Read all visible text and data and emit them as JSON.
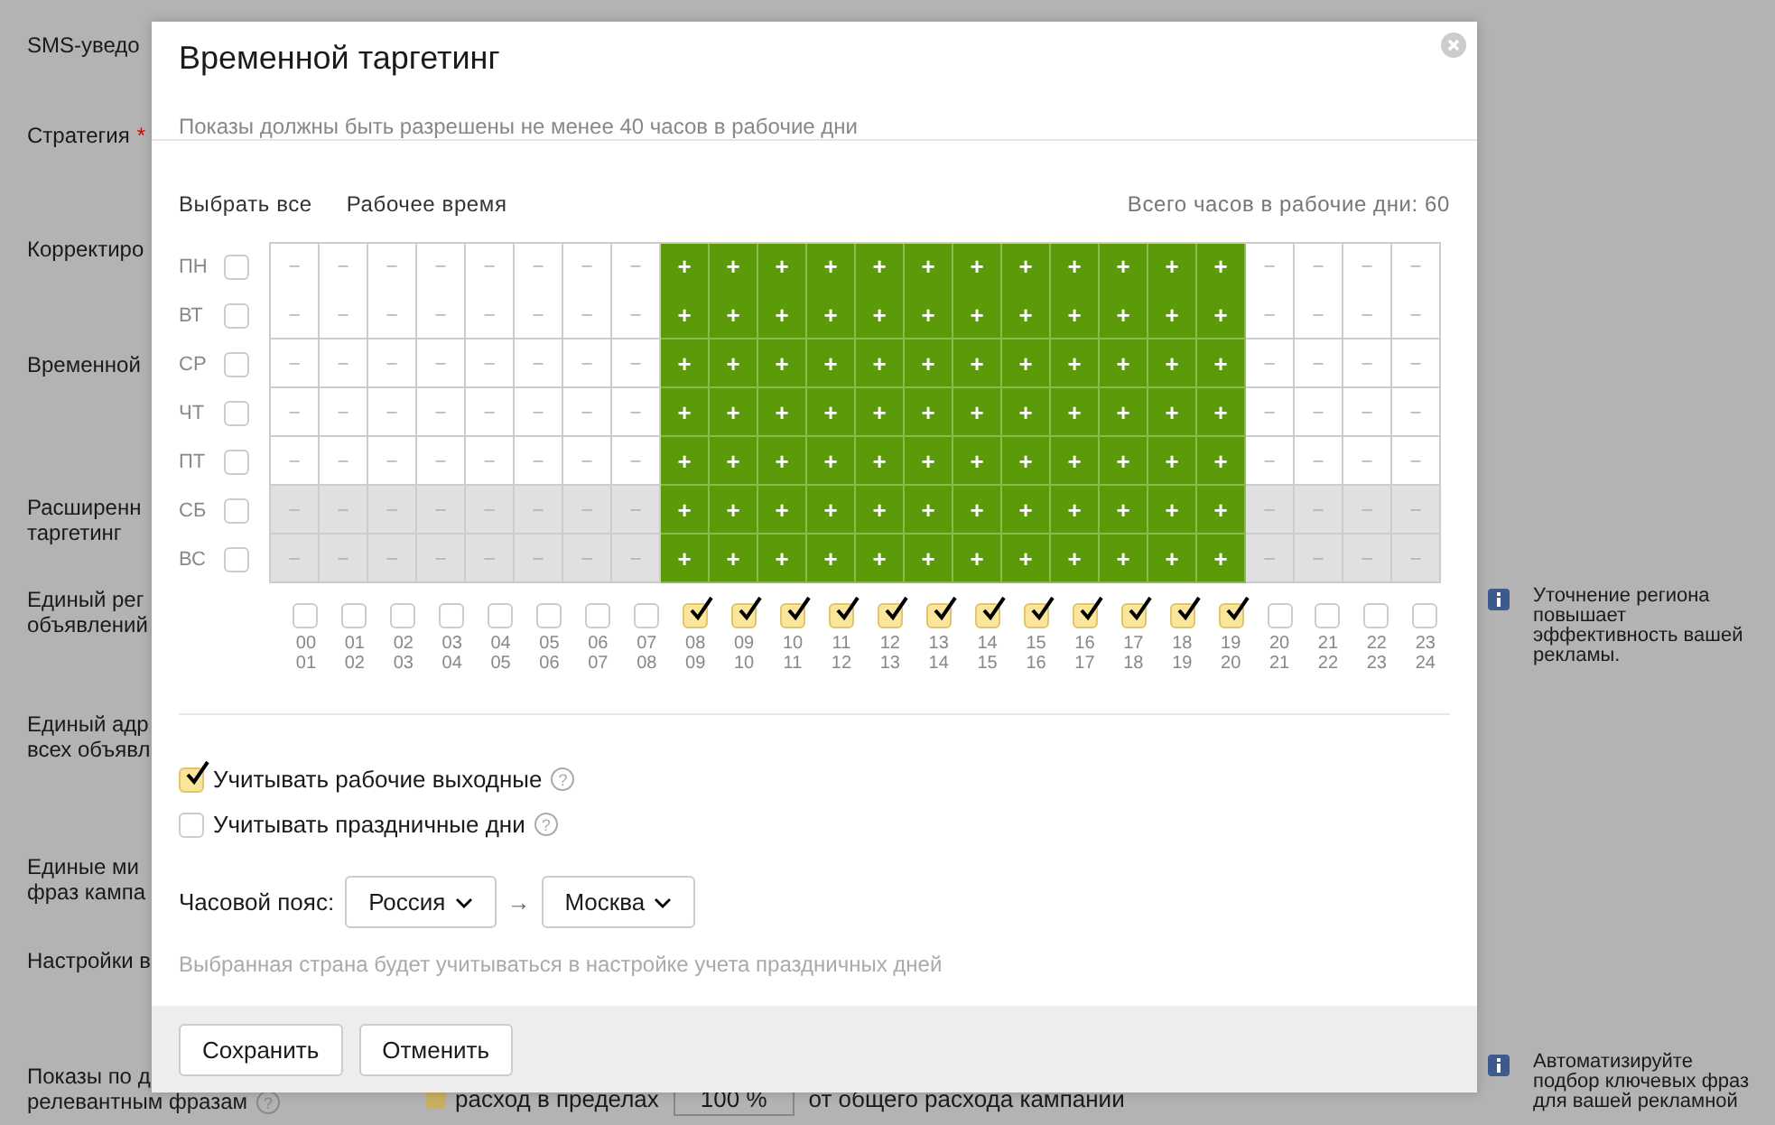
{
  "background_form": {
    "labels": [
      {
        "text": "SMS-уведо"
      },
      {
        "text": "Стратегия",
        "marker": "*"
      },
      {
        "text": "Корректиро"
      },
      {
        "text": "Временной"
      },
      {
        "text": "Расширенн\nтаргетинг"
      },
      {
        "text": "Единый рег\nобъявлений"
      },
      {
        "text": "Единый адр\nвсех объявл"
      },
      {
        "text": "Единые ми\nфраз кампа"
      },
      {
        "text": "Настройки в"
      },
      {
        "text": "Показы по д\nрелевантным фразам",
        "help": "?"
      }
    ],
    "hints": [
      "Уточнение региона повышает эффективность вашей рекламы.",
      "Автоматизируйте подбор ключевых фраз для вашей рекламной"
    ],
    "spend": {
      "checked": true,
      "label": "расход в пределах",
      "value": "100 %",
      "suffix": "от общего расхода кампании"
    }
  },
  "dialog": {
    "title": "Временной таргетинг",
    "subtitle": "Показы должны быть разрешены не менее 40 часов в рабочие дни",
    "links": [
      "Выбрать все",
      "Рабочее время"
    ],
    "total": "Всего часов в рабочие дни: 60",
    "days": [
      {
        "label": "ПН",
        "checked": false,
        "weekend": false,
        "cells": [
          {
            "mark": "–",
            "on": false
          },
          {
            "mark": "–",
            "on": false
          },
          {
            "mark": "–",
            "on": false
          },
          {
            "mark": "–",
            "on": false
          },
          {
            "mark": "–",
            "on": false
          },
          {
            "mark": "–",
            "on": false
          },
          {
            "mark": "–",
            "on": false
          },
          {
            "mark": "–",
            "on": false
          },
          {
            "mark": "+",
            "on": true
          },
          {
            "mark": "+",
            "on": true
          },
          {
            "mark": "+",
            "on": true
          },
          {
            "mark": "+",
            "on": true
          },
          {
            "mark": "+",
            "on": true
          },
          {
            "mark": "+",
            "on": true
          },
          {
            "mark": "+",
            "on": true
          },
          {
            "mark": "+",
            "on": true
          },
          {
            "mark": "+",
            "on": true
          },
          {
            "mark": "+",
            "on": true
          },
          {
            "mark": "+",
            "on": true
          },
          {
            "mark": "+",
            "on": true
          },
          {
            "mark": "–",
            "on": false
          },
          {
            "mark": "–",
            "on": false
          },
          {
            "mark": "–",
            "on": false
          },
          {
            "mark": "–",
            "on": false
          }
        ]
      },
      {
        "label": "ВТ",
        "checked": false,
        "weekend": false,
        "cells": [
          {
            "mark": "–",
            "on": false
          },
          {
            "mark": "–",
            "on": false
          },
          {
            "mark": "–",
            "on": false
          },
          {
            "mark": "–",
            "on": false
          },
          {
            "mark": "–",
            "on": false
          },
          {
            "mark": "–",
            "on": false
          },
          {
            "mark": "–",
            "on": false
          },
          {
            "mark": "–",
            "on": false
          },
          {
            "mark": "+",
            "on": true
          },
          {
            "mark": "+",
            "on": true
          },
          {
            "mark": "+",
            "on": true
          },
          {
            "mark": "+",
            "on": true
          },
          {
            "mark": "+",
            "on": true
          },
          {
            "mark": "+",
            "on": true
          },
          {
            "mark": "+",
            "on": true
          },
          {
            "mark": "+",
            "on": true
          },
          {
            "mark": "+",
            "on": true
          },
          {
            "mark": "+",
            "on": true
          },
          {
            "mark": "+",
            "on": true
          },
          {
            "mark": "+",
            "on": true
          },
          {
            "mark": "–",
            "on": false
          },
          {
            "mark": "–",
            "on": false
          },
          {
            "mark": "–",
            "on": false
          },
          {
            "mark": "–",
            "on": false
          }
        ]
      },
      {
        "label": "СР",
        "checked": false,
        "weekend": false,
        "cells": [
          {
            "mark": "–",
            "on": false
          },
          {
            "mark": "–",
            "on": false
          },
          {
            "mark": "–",
            "on": false
          },
          {
            "mark": "–",
            "on": false
          },
          {
            "mark": "–",
            "on": false
          },
          {
            "mark": "–",
            "on": false
          },
          {
            "mark": "–",
            "on": false
          },
          {
            "mark": "–",
            "on": false
          },
          {
            "mark": "+",
            "on": true
          },
          {
            "mark": "+",
            "on": true
          },
          {
            "mark": "+",
            "on": true
          },
          {
            "mark": "+",
            "on": true
          },
          {
            "mark": "+",
            "on": true
          },
          {
            "mark": "+",
            "on": true
          },
          {
            "mark": "+",
            "on": true
          },
          {
            "mark": "+",
            "on": true
          },
          {
            "mark": "+",
            "on": true
          },
          {
            "mark": "+",
            "on": true
          },
          {
            "mark": "+",
            "on": true
          },
          {
            "mark": "+",
            "on": true
          },
          {
            "mark": "–",
            "on": false
          },
          {
            "mark": "–",
            "on": false
          },
          {
            "mark": "–",
            "on": false
          },
          {
            "mark": "–",
            "on": false
          }
        ]
      },
      {
        "label": "ЧТ",
        "checked": false,
        "weekend": false,
        "cells": [
          {
            "mark": "–",
            "on": false
          },
          {
            "mark": "–",
            "on": false
          },
          {
            "mark": "–",
            "on": false
          },
          {
            "mark": "–",
            "on": false
          },
          {
            "mark": "–",
            "on": false
          },
          {
            "mark": "–",
            "on": false
          },
          {
            "mark": "–",
            "on": false
          },
          {
            "mark": "–",
            "on": false
          },
          {
            "mark": "+",
            "on": true
          },
          {
            "mark": "+",
            "on": true
          },
          {
            "mark": "+",
            "on": true
          },
          {
            "mark": "+",
            "on": true
          },
          {
            "mark": "+",
            "on": true
          },
          {
            "mark": "+",
            "on": true
          },
          {
            "mark": "+",
            "on": true
          },
          {
            "mark": "+",
            "on": true
          },
          {
            "mark": "+",
            "on": true
          },
          {
            "mark": "+",
            "on": true
          },
          {
            "mark": "+",
            "on": true
          },
          {
            "mark": "+",
            "on": true
          },
          {
            "mark": "–",
            "on": false
          },
          {
            "mark": "–",
            "on": false
          },
          {
            "mark": "–",
            "on": false
          },
          {
            "mark": "–",
            "on": false
          }
        ]
      },
      {
        "label": "ПТ",
        "checked": false,
        "weekend": false,
        "cells": [
          {
            "mark": "–",
            "on": false
          },
          {
            "mark": "–",
            "on": false
          },
          {
            "mark": "–",
            "on": false
          },
          {
            "mark": "–",
            "on": false
          },
          {
            "mark": "–",
            "on": false
          },
          {
            "mark": "–",
            "on": false
          },
          {
            "mark": "–",
            "on": false
          },
          {
            "mark": "–",
            "on": false
          },
          {
            "mark": "+",
            "on": true
          },
          {
            "mark": "+",
            "on": true
          },
          {
            "mark": "+",
            "on": true
          },
          {
            "mark": "+",
            "on": true
          },
          {
            "mark": "+",
            "on": true
          },
          {
            "mark": "+",
            "on": true
          },
          {
            "mark": "+",
            "on": true
          },
          {
            "mark": "+",
            "on": true
          },
          {
            "mark": "+",
            "on": true
          },
          {
            "mark": "+",
            "on": true
          },
          {
            "mark": "+",
            "on": true
          },
          {
            "mark": "+",
            "on": true
          },
          {
            "mark": "–",
            "on": false
          },
          {
            "mark": "–",
            "on": false
          },
          {
            "mark": "–",
            "on": false
          },
          {
            "mark": "–",
            "on": false
          }
        ]
      },
      {
        "label": "СБ",
        "checked": false,
        "weekend": true,
        "cells": [
          {
            "mark": "–",
            "on": false
          },
          {
            "mark": "–",
            "on": false
          },
          {
            "mark": "–",
            "on": false
          },
          {
            "mark": "–",
            "on": false
          },
          {
            "mark": "–",
            "on": false
          },
          {
            "mark": "–",
            "on": false
          },
          {
            "mark": "–",
            "on": false
          },
          {
            "mark": "–",
            "on": false
          },
          {
            "mark": "+",
            "on": true
          },
          {
            "mark": "+",
            "on": true
          },
          {
            "mark": "+",
            "on": true
          },
          {
            "mark": "+",
            "on": true
          },
          {
            "mark": "+",
            "on": true
          },
          {
            "mark": "+",
            "on": true
          },
          {
            "mark": "+",
            "on": true
          },
          {
            "mark": "+",
            "on": true
          },
          {
            "mark": "+",
            "on": true
          },
          {
            "mark": "+",
            "on": true
          },
          {
            "mark": "+",
            "on": true
          },
          {
            "mark": "+",
            "on": true
          },
          {
            "mark": "–",
            "on": false
          },
          {
            "mark": "–",
            "on": false
          },
          {
            "mark": "–",
            "on": false
          },
          {
            "mark": "–",
            "on": false
          }
        ]
      },
      {
        "label": "ВС",
        "checked": false,
        "weekend": true,
        "cells": [
          {
            "mark": "–",
            "on": false
          },
          {
            "mark": "–",
            "on": false
          },
          {
            "mark": "–",
            "on": false
          },
          {
            "mark": "–",
            "on": false
          },
          {
            "mark": "–",
            "on": false
          },
          {
            "mark": "–",
            "on": false
          },
          {
            "mark": "–",
            "on": false
          },
          {
            "mark": "–",
            "on": false
          },
          {
            "mark": "+",
            "on": true
          },
          {
            "mark": "+",
            "on": true
          },
          {
            "mark": "+",
            "on": true
          },
          {
            "mark": "+",
            "on": true
          },
          {
            "mark": "+",
            "on": true
          },
          {
            "mark": "+",
            "on": true
          },
          {
            "mark": "+",
            "on": true
          },
          {
            "mark": "+",
            "on": true
          },
          {
            "mark": "+",
            "on": true
          },
          {
            "mark": "+",
            "on": true
          },
          {
            "mark": "+",
            "on": true
          },
          {
            "mark": "+",
            "on": true
          },
          {
            "mark": "–",
            "on": false
          },
          {
            "mark": "–",
            "on": false
          },
          {
            "mark": "–",
            "on": false
          },
          {
            "mark": "–",
            "on": false
          }
        ]
      }
    ],
    "hours": [
      {
        "from": "00",
        "to": "01",
        "checked": false
      },
      {
        "from": "01",
        "to": "02",
        "checked": false
      },
      {
        "from": "02",
        "to": "03",
        "checked": false
      },
      {
        "from": "03",
        "to": "04",
        "checked": false
      },
      {
        "from": "04",
        "to": "05",
        "checked": false
      },
      {
        "from": "05",
        "to": "06",
        "checked": false
      },
      {
        "from": "06",
        "to": "07",
        "checked": false
      },
      {
        "from": "07",
        "to": "08",
        "checked": false
      },
      {
        "from": "08",
        "to": "09",
        "checked": true
      },
      {
        "from": "09",
        "to": "10",
        "checked": true
      },
      {
        "from": "10",
        "to": "11",
        "checked": true
      },
      {
        "from": "11",
        "to": "12",
        "checked": true
      },
      {
        "from": "12",
        "to": "13",
        "checked": true
      },
      {
        "from": "13",
        "to": "14",
        "checked": true
      },
      {
        "from": "14",
        "to": "15",
        "checked": true
      },
      {
        "from": "15",
        "to": "16",
        "checked": true
      },
      {
        "from": "16",
        "to": "17",
        "checked": true
      },
      {
        "from": "17",
        "to": "18",
        "checked": true
      },
      {
        "from": "18",
        "to": "19",
        "checked": true
      },
      {
        "from": "19",
        "to": "20",
        "checked": true
      },
      {
        "from": "20",
        "to": "21",
        "checked": false
      },
      {
        "from": "21",
        "to": "22",
        "checked": false
      },
      {
        "from": "22",
        "to": "23",
        "checked": false
      },
      {
        "from": "23",
        "to": "24",
        "checked": false
      }
    ],
    "options": [
      {
        "label": "Учитывать рабочие выходные",
        "checked": true,
        "help": "?"
      },
      {
        "label": "Учитывать праздничные дни",
        "checked": false,
        "help": "?"
      }
    ],
    "timezone": {
      "label": "Часовой пояс:",
      "country": "Россия",
      "arrow": "→",
      "city": "Москва"
    },
    "note": "Выбранная страна будет учитываться в настройке учета праздничных дней",
    "buttons": [
      "Сохранить",
      "Отменить"
    ]
  }
}
